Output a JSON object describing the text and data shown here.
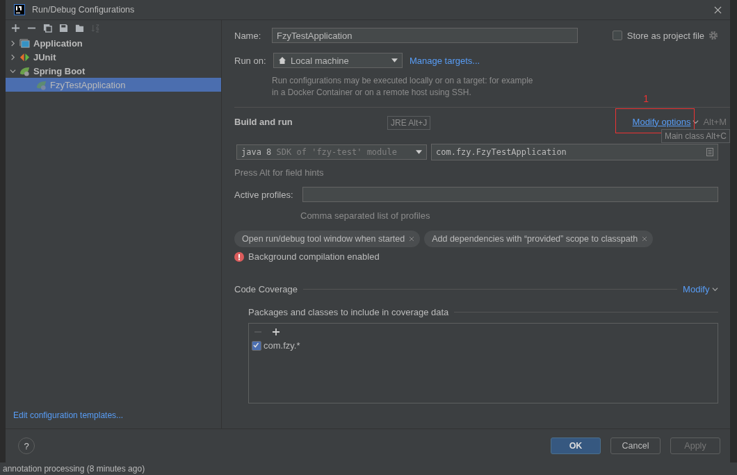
{
  "window": {
    "title": "Run/Debug Configurations"
  },
  "toolbar_icons": [
    {
      "kind": "add",
      "disabled": false
    },
    {
      "kind": "remove",
      "disabled": false
    },
    {
      "kind": "copy",
      "disabled": false
    },
    {
      "kind": "save",
      "disabled": false
    },
    {
      "kind": "folder",
      "disabled": false
    },
    {
      "kind": "sort",
      "disabled": true
    }
  ],
  "tree": [
    {
      "label": "Application",
      "kind": "application",
      "expanded": false,
      "selected": false
    },
    {
      "label": "JUnit",
      "kind": "junit",
      "expanded": false,
      "selected": false
    },
    {
      "label": "Spring Boot",
      "kind": "spring",
      "expanded": true,
      "selected": false,
      "children": [
        {
          "label": "FzyTestApplication",
          "kind": "spring",
          "selected": true
        }
      ]
    }
  ],
  "edit_templates_link": "Edit configuration templates...",
  "name": {
    "label": "Name:",
    "value": "FzyTestApplication"
  },
  "store_checkbox": {
    "label": "Store as project file",
    "checked": false
  },
  "run_on": {
    "label": "Run on:",
    "value": "Local machine",
    "link": "Manage targets..."
  },
  "run_on_description": "Run configurations may be executed locally or on a target: for example in a Docker Container or on a remote host using SSH.",
  "build_section": {
    "title": "Build and run",
    "modify_options": "Modify options",
    "shortcut": "Alt+M",
    "annotation_number": "1"
  },
  "jre": {
    "value": "java 8",
    "hint": "SDK of 'fzy-test' module"
  },
  "main_class": {
    "value": "com.fzy.FzyTestApplication"
  },
  "tooltips": [
    {
      "text": "JRE Alt+J"
    },
    {
      "text": "Main class Alt+C"
    }
  ],
  "field_hint": "Press Alt for field hints",
  "active_profiles": {
    "label": "Active profiles:",
    "help": "Comma separated list of profiles"
  },
  "option_chips": [
    "Open run/debug tool window when started",
    "Add dependencies with “provided” scope to classpath"
  ],
  "warning": "Background compilation enabled",
  "code_coverage": {
    "title": "Code Coverage",
    "modify": "Modify",
    "packages_title": "Packages and classes to include in coverage data",
    "items": [
      {
        "label": "com.fzy.*",
        "checked": true
      }
    ]
  },
  "buttons": [
    {
      "label": "OK",
      "kind": "primary",
      "disabled": false
    },
    {
      "label": "Cancel",
      "kind": "normal",
      "disabled": false
    },
    {
      "label": "Apply",
      "kind": "normal",
      "disabled": true
    }
  ],
  "help_button": "?",
  "status_bar": "annotation processing (8 minutes ago)"
}
